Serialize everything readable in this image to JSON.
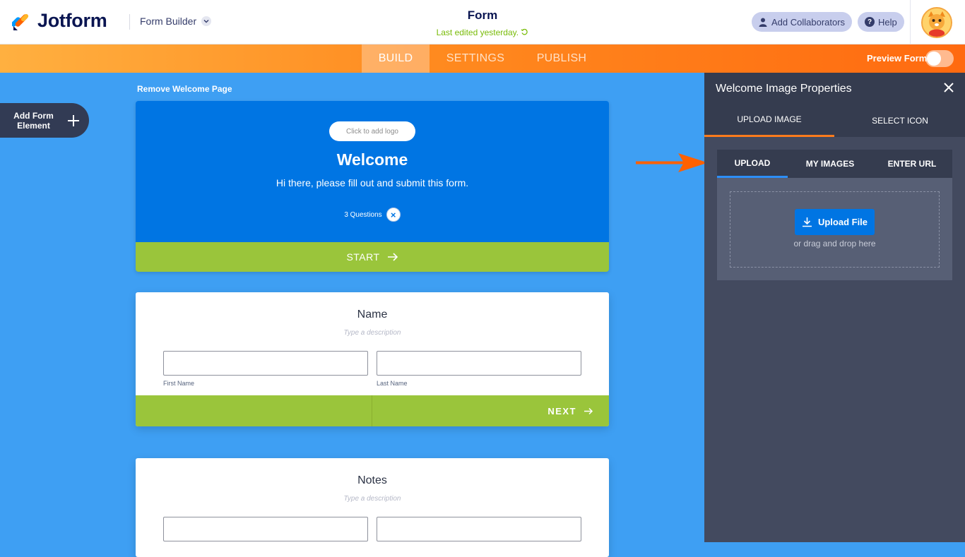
{
  "header": {
    "logo_text": "Jotform",
    "builder_label": "Form Builder",
    "form_title": "Form",
    "last_edited": "Last edited yesterday.",
    "add_collaborators": "Add Collaborators",
    "help": "Help"
  },
  "nav": {
    "tabs": [
      {
        "label": "BUILD"
      },
      {
        "label": "SETTINGS"
      },
      {
        "label": "PUBLISH"
      }
    ],
    "active_tab": "BUILD",
    "preview_label": "Preview Form",
    "preview_on": false
  },
  "sidebar": {
    "add_element_label": "Add Form Element"
  },
  "welcome": {
    "remove_label": "Remove Welcome Page",
    "logo_placeholder": "Click to add logo",
    "title": "Welcome",
    "subtitle": "Hi there, please fill out and submit this form.",
    "questions": "3 Questions",
    "start_label": "START"
  },
  "cards": [
    {
      "title": "Name",
      "description": "Type a description",
      "first_label": "First Name",
      "last_label": "Last Name",
      "next_label": "NEXT"
    },
    {
      "title": "Notes",
      "description": "Type a description"
    }
  ],
  "panel": {
    "title": "Welcome Image Properties",
    "tabs": [
      {
        "label": "UPLOAD IMAGE"
      },
      {
        "label": "SELECT ICON"
      }
    ],
    "inner_tabs": [
      {
        "label": "UPLOAD"
      },
      {
        "label": "MY IMAGES"
      },
      {
        "label": "ENTER URL"
      }
    ],
    "upload_button": "Upload File",
    "drag_text": "or drag and drop here"
  },
  "colors": {
    "brand_navy": "#0a1551",
    "nav_orange": "#ff7b1c",
    "canvas_blue": "#3e9ff3",
    "welcome_blue": "#0075e3",
    "action_green": "#9ac53b",
    "panel_dark": "#434a5f"
  }
}
